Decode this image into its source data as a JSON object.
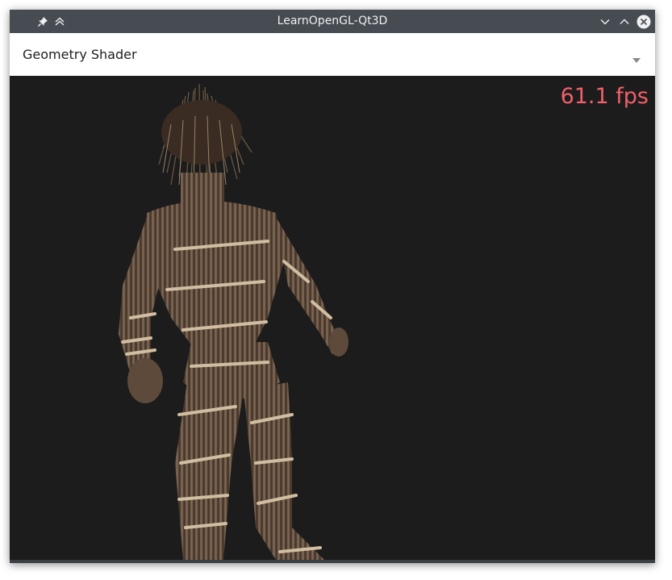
{
  "window": {
    "title": "LearnOpenGL-Qt3D"
  },
  "titlebar": {
    "left_icons": [
      "pin-icon",
      "keep-above-icon"
    ],
    "right_icons": [
      "minimize-icon",
      "maximize-icon",
      "close-icon"
    ]
  },
  "shader_select": {
    "selected": "Geometry Shader",
    "icon": "chevron-down-icon"
  },
  "viewport": {
    "fps_text": "61.1 fps",
    "fps_color": "#f25f6b",
    "background": "#1c1c1c"
  },
  "colors": {
    "titlebar": "#474c52",
    "title_text": "#eff0f1",
    "model_bark": "#6b5443",
    "model_straps": "#c9b59a"
  }
}
